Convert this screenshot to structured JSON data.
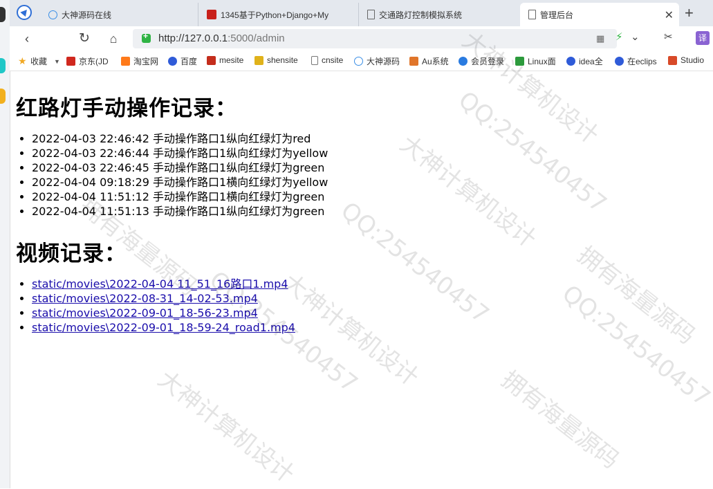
{
  "browser": {
    "tabs": [
      {
        "title": "大神源码在线"
      },
      {
        "title": "1345基于Python+Django+My"
      },
      {
        "title": "交通路灯控制模拟系统"
      },
      {
        "title": "管理后台"
      }
    ],
    "address": {
      "host": "http://127.0.0.1",
      "port_path": ":5000/admin"
    },
    "bookmarks": [
      "收藏",
      "京东(JD",
      "淘宝网",
      "百度",
      "mesite",
      "shensite",
      "cnsite",
      "大神源码",
      "Au系统",
      "会员登录",
      "Linux面",
      "idea全",
      "在eclips",
      "Studio"
    ],
    "translate_label": "译"
  },
  "page": {
    "section1_title": "红路灯手动操作记录：",
    "records": [
      "2022-04-03 22:46:42 手动操作路口1纵向红绿灯为red",
      "2022-04-03 22:46:44 手动操作路口1纵向红绿灯为yellow",
      "2022-04-03 22:46:45 手动操作路口1纵向红绿灯为green",
      "2022-04-04 09:18:29 手动操作路口1横向红绿灯为yellow",
      "2022-04-04 11:51:12 手动操作路口1横向红绿灯为green",
      "2022-04-04 11:51:13 手动操作路口1纵向红绿灯为green"
    ],
    "section2_title": "视频记录：",
    "videos": [
      "static/movies\\2022-04-04 11_51_16路口1.mp4",
      "static/movies\\2022-08-31_14-02-53.mp4",
      "static/movies\\2022-09-01_18-56-23.mp4",
      "static/movies\\2022-09-01_18-59-24_road1.mp4"
    ]
  },
  "watermarks": [
    "QQ:254540457",
    "大神计算机设计",
    "拥有海量源码"
  ]
}
